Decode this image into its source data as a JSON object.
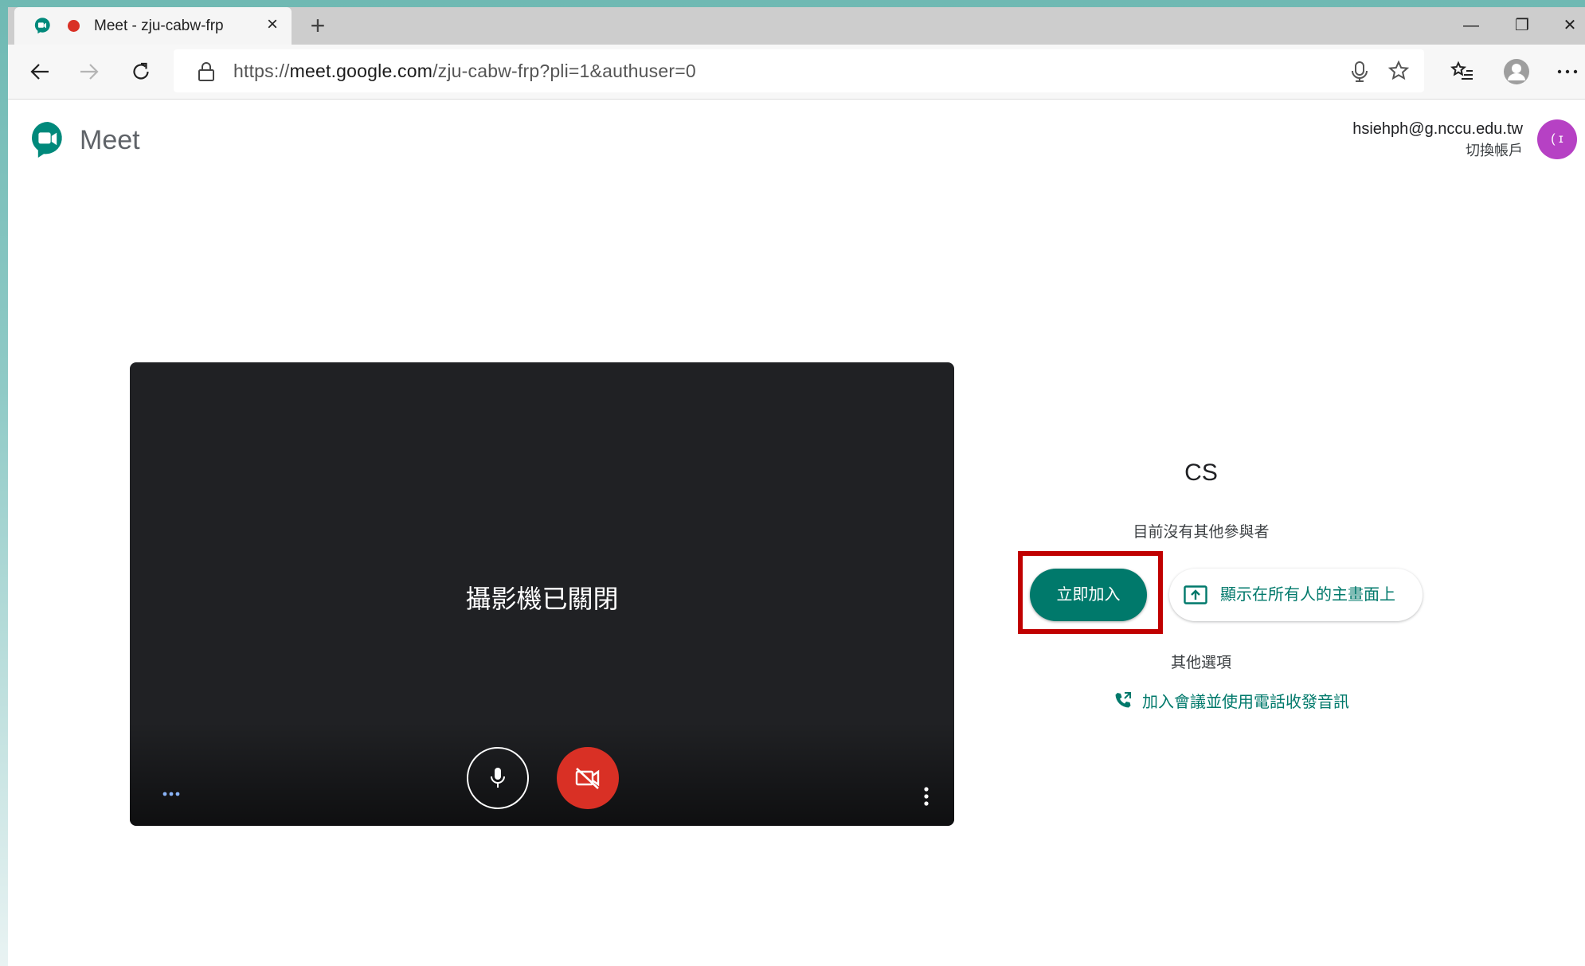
{
  "browser": {
    "tab": {
      "title": "Meet - zju-cabw-frp"
    },
    "new_tab_label": "+",
    "address": {
      "scheme": "https://",
      "host": "meet.google.com",
      "path": "/zju-cabw-frp?pli=1&authuser=0"
    },
    "window_controls": {
      "minimize": "—",
      "restore": "❐",
      "close": "✕"
    },
    "icons": {
      "back": "arrow-left-icon",
      "forward": "arrow-right-icon",
      "refresh": "refresh-icon",
      "lock": "lock-icon",
      "mic": "microphone-icon",
      "favorite": "star-icon",
      "favorites_list": "favorites-list-icon",
      "profile": "profile-icon",
      "menu": "more-horizontal-icon"
    },
    "colors": {
      "record_dot": "#d93025"
    }
  },
  "header": {
    "logo_text": "Meet",
    "account_email": "hsiehph@g.nccu.edu.tw",
    "switch_account": "切換帳戶"
  },
  "preview": {
    "camera_off_text": "攝影機已關閉",
    "colors": {
      "background": "#202124",
      "camera_off_button": "#d93025"
    }
  },
  "join_panel": {
    "meeting_name": "CS",
    "status": "目前沒有其他參與者",
    "join_button": "立即加入",
    "present_button": "顯示在所有人的主畫面上",
    "other_options": "其他選項",
    "phone_link": "加入會議並使用電話收發音訊",
    "colors": {
      "accent": "#00796b",
      "highlight": "#c00000"
    }
  }
}
